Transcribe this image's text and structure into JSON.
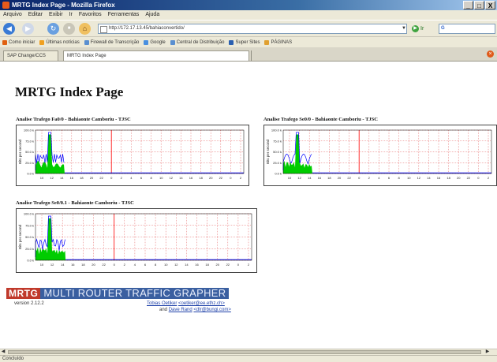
{
  "window": {
    "title": "MRTG Index Page - Mozilla Firefox",
    "minimize": "_",
    "maximize": "□",
    "close": "X"
  },
  "menu": [
    "Arquivo",
    "Editar",
    "Exibir",
    "Ir",
    "Favoritos",
    "Ferramentas",
    "Ajuda"
  ],
  "nav": {
    "back": "◀",
    "forward": "▶",
    "reload": "↻",
    "stop": "■",
    "home": "⌂",
    "url": "http://172.17.13.45/bahiaconvertido/",
    "go_label": "Ir",
    "search_placeholder": "G"
  },
  "bookmarks": [
    {
      "label": "Como iniciar",
      "color": "#e06010"
    },
    {
      "label": "Últimas notícias",
      "color": "#f0a020"
    },
    {
      "label": "Firewall de Transcrição",
      "color": "#5a8fd0"
    },
    {
      "label": "Google",
      "color": "#4a90e0"
    },
    {
      "label": "Central de Distribuição",
      "color": "#5a8fd0"
    },
    {
      "label": "Super Sites",
      "color": "#2a5fb0"
    },
    {
      "label": "PÁGINAS",
      "color": "#e0a030"
    }
  ],
  "tabs": [
    {
      "label": "SAP Change/CCS",
      "active": false
    },
    {
      "label": "MRTG Index Page",
      "active": true
    }
  ],
  "tab_close": "×",
  "page": {
    "title": "MRTG Index Page",
    "graphs": [
      {
        "title": "Analise Trafego Fa0/0 - Bahiaonte Camboriu - TJSC",
        "y_axis_label": "Bits per second",
        "y_ticks": [
          "100.0 k",
          "75.0 k",
          "50.0 k",
          "25.0 k",
          "0.0 k"
        ],
        "x_ticks": [
          "10",
          "12",
          "14",
          "16",
          "18",
          "20",
          "22",
          "0",
          "2",
          "4",
          "6",
          "8",
          "10",
          "12",
          "14",
          "16",
          "18",
          "20",
          "22",
          "0",
          "2"
        ]
      },
      {
        "title": "Analise Trafego Se0/0 - Bahiaonte Camboriu - TJSC",
        "y_axis_label": "Bits per second",
        "y_ticks": [
          "100.0 k",
          "75.0 k",
          "50.0 k",
          "25.0 k",
          "0.0 k"
        ],
        "x_ticks": [
          "10",
          "12",
          "14",
          "16",
          "18",
          "20",
          "22",
          "0",
          "2",
          "4",
          "6",
          "8",
          "10",
          "12",
          "14",
          "16",
          "18",
          "20",
          "22",
          "0",
          "2"
        ]
      },
      {
        "title": "Analise Trafego Se0/0.1 - Bahiaonte Camboriu - TJSC",
        "y_axis_label": "Bits per second",
        "y_ticks": [
          "100.0 k",
          "75.0 k",
          "50.0 k",
          "25.0 k",
          "0.0 k"
        ],
        "x_ticks": [
          "10",
          "12",
          "14",
          "16",
          "18",
          "20",
          "22",
          "0",
          "2",
          "4",
          "6",
          "8",
          "10",
          "12",
          "14",
          "16",
          "18",
          "20",
          "22",
          "0",
          "2"
        ]
      }
    ]
  },
  "mrtg": {
    "logo_left": "MRTG",
    "logo_right": "MULTI ROUTER TRAFFIC GRAPHER",
    "version": "version 2.12.2",
    "author1_name": "Tobias Oetiker",
    "author1_email": "<oetiker@ee.ethz.ch>",
    "author2_prefix": "and",
    "author2_name": "Dave Rand",
    "author2_email": "<dlr@bungi.com>"
  },
  "status": {
    "text": "Concluído"
  },
  "colors": {
    "incoming": "#00cc00",
    "outgoing": "#0000ff",
    "grid": "#e04040",
    "midnight": "#ff0000"
  }
}
